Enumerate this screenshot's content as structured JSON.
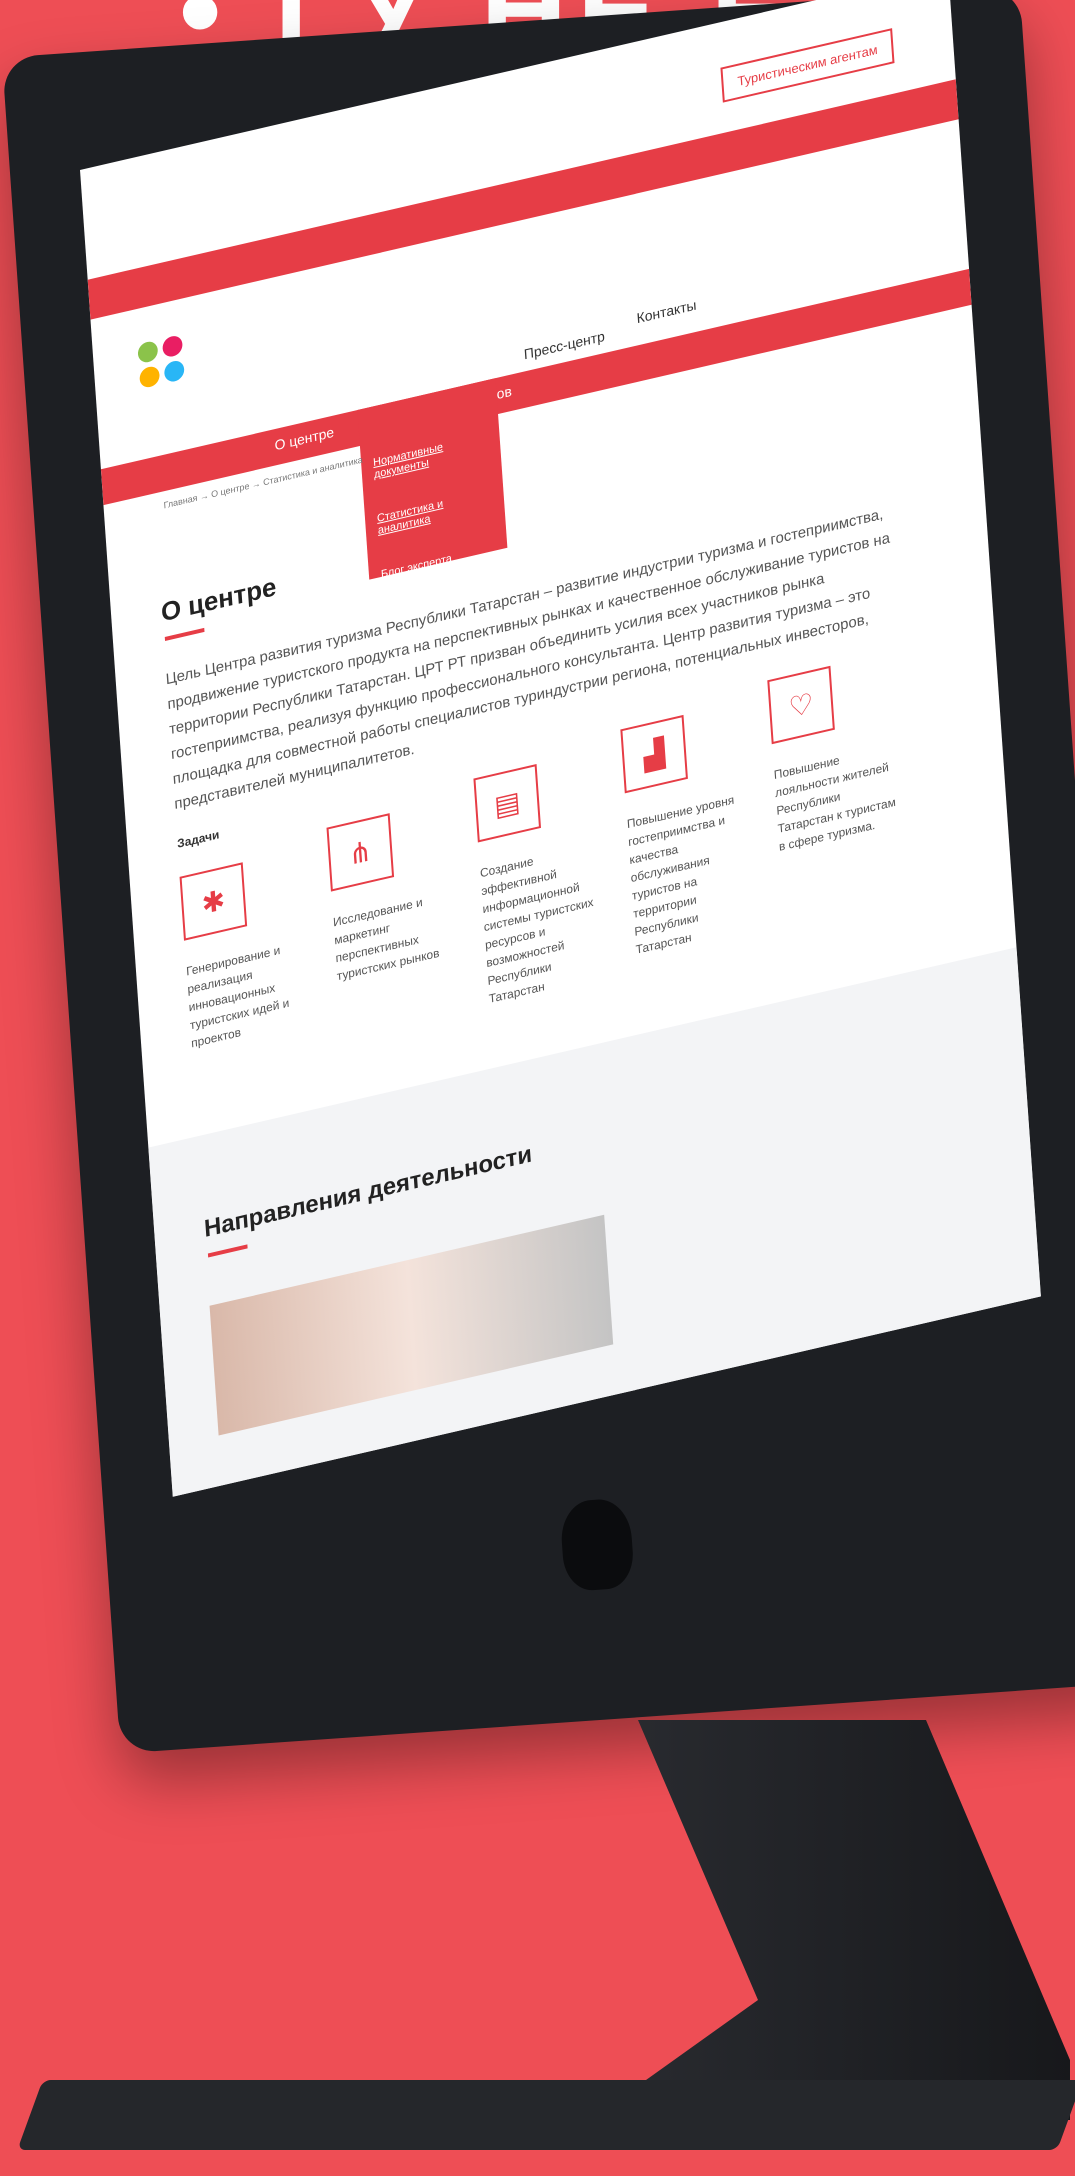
{
  "nav": {
    "items": [
      "О центре",
      "Для профессионалов",
      "Пресс-центр",
      "Контакты"
    ],
    "dropdown": [
      "Нормативные документы",
      "Статистика и аналитика",
      "Блог эксперта"
    ]
  },
  "header": {
    "cta_label": "Туристическим агентам"
  },
  "breadcrumb": "Главная → О центре → Статистика и аналитика",
  "page": {
    "title": "О центре",
    "body": "Цель Центра развития туризма Республики Татарстан – развитие индустрии туризма и гостеприимства, продвижение туристского продукта на перспективных рынках и качественное обслуживание туристов на территории Республики Татарстан. ЦРТ РТ призван объединить усилия всех участников рынка гостеприимства, реализуя функцию профессионального консультанта. Центр развития туризма – это площадка для совместной работы специалистов туриндустрии региона, потенциальных инвесторов, представителей муниципалитетов."
  },
  "tasks": {
    "title": "Задачи",
    "items": [
      {
        "icon": "lightbulb-icon",
        "text": "Генерирование и реализация инновационных туристских идей и проектов"
      },
      {
        "icon": "network-icon",
        "text": "Исследование и маркетинг перспективных туристских рынков"
      },
      {
        "icon": "document-icon",
        "text": "Создание эффективной информационной системы туристских ресурсов и возможностей Республики Татарстан"
      },
      {
        "icon": "chart-icon",
        "text": "Повышение уровня гостеприимства и качества обслуживания туристов на территории Республики Татарстан"
      },
      {
        "icon": "heart-icon",
        "text": "Повышение лояльности жителей Республики Татарстан к туристам в сфере туризма."
      }
    ]
  },
  "directions": {
    "title": "Направления деятельности"
  }
}
